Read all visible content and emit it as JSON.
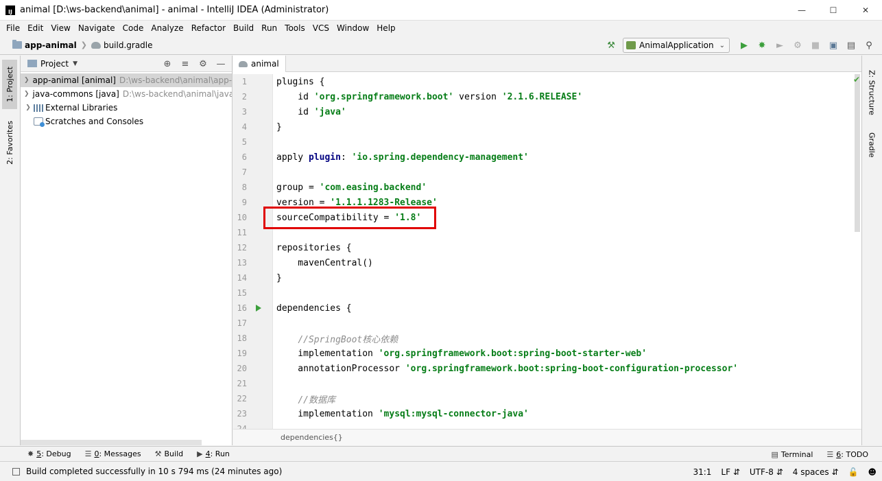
{
  "window": {
    "title": "animal [D:\\ws-backend\\animal] - animal - IntelliJ IDEA (Administrator)",
    "app_icon_letters": "IJ"
  },
  "menu": [
    "File",
    "Edit",
    "View",
    "Navigate",
    "Code",
    "Analyze",
    "Refactor",
    "Build",
    "Run",
    "Tools",
    "VCS",
    "Window",
    "Help"
  ],
  "nav": {
    "project": "app-animal",
    "file": "build.gradle",
    "run_config": "AnimalApplication"
  },
  "left_strip": {
    "project_tab": "1: Project",
    "favorites_tab": "2: Favorites"
  },
  "right_strip": {
    "structure_tab": "Z: Structure",
    "gradle_tab": "Gradle"
  },
  "project_panel": {
    "title": "Project",
    "tree": [
      {
        "name": "app-animal [animal]",
        "path": "D:\\ws-backend\\animal\\app-a",
        "selected": true,
        "icon": "module-folder-icon"
      },
      {
        "name": "java-commons [java]",
        "path": "D:\\ws-backend\\animal\\java-",
        "selected": false,
        "icon": "module-folder-icon"
      },
      {
        "name": "External Libraries",
        "path": "",
        "selected": false,
        "icon": "library-icon"
      },
      {
        "name": "Scratches and Consoles",
        "path": "",
        "selected": false,
        "icon": "scratches-icon"
      }
    ]
  },
  "editor": {
    "tab_label": "animal",
    "breadcrumb": "dependencies{}",
    "lines": [
      {
        "n": "1",
        "html": "plugins {"
      },
      {
        "n": "2",
        "html": "    id <span class=\"s\">'org.springframework.boot'</span> version <span class=\"s\">'2.1.6.RELEASE'</span>"
      },
      {
        "n": "3",
        "html": "    id <span class=\"s\">'java'</span>"
      },
      {
        "n": "4",
        "html": "}"
      },
      {
        "n": "5",
        "html": ""
      },
      {
        "n": "6",
        "html": "apply <span class=\"k\">plugin</span>: <span class=\"s\">'io.spring.dependency-management'</span>"
      },
      {
        "n": "7",
        "html": ""
      },
      {
        "n": "8",
        "html": "group = <span class=\"s\">'com.easing.backend'</span>"
      },
      {
        "n": "9",
        "html": "version = <span class=\"s\">'1.1.1.1283-Release'</span>"
      },
      {
        "n": "10",
        "html": "sourceCompatibility = <span class=\"s\">'1.8'</span>"
      },
      {
        "n": "11",
        "html": ""
      },
      {
        "n": "12",
        "html": "repositories {"
      },
      {
        "n": "13",
        "html": "    mavenCentral()"
      },
      {
        "n": "14",
        "html": "}"
      },
      {
        "n": "15",
        "html": ""
      },
      {
        "n": "16",
        "html": "dependencies {"
      },
      {
        "n": "17",
        "html": ""
      },
      {
        "n": "18",
        "html": "    <span class=\"c\">//SpringBoot核心依赖</span>"
      },
      {
        "n": "19",
        "html": "    implementation <span class=\"s\">'org.springframework.boot:spring-boot-starter-web'</span>"
      },
      {
        "n": "20",
        "html": "    annotationProcessor <span class=\"s\">'org.springframework.boot:spring-boot-configuration-processor'</span>"
      },
      {
        "n": "21",
        "html": ""
      },
      {
        "n": "22",
        "html": "    <span class=\"c\">//数据库</span>"
      },
      {
        "n": "23",
        "html": "    implementation <span class=\"s\">'mysql:mysql-connector-java'</span>"
      },
      {
        "n": "24",
        "html": ""
      }
    ]
  },
  "bottom_tools": [
    {
      "num": "5",
      "rest": ": Debug",
      "icon": "bug-icon"
    },
    {
      "num": "0",
      "rest": ": Messages",
      "icon": "messages-icon"
    },
    {
      "num": "",
      "rest": "Build",
      "icon": "hammer-icon"
    },
    {
      "num": "4",
      "rest": ": Run",
      "icon": "run-icon"
    }
  ],
  "bottom_tools_right": {
    "terminal": "Terminal",
    "todo_num": "6",
    "todo_rest": ": TODO"
  },
  "status": {
    "message": "Build completed successfully in 10 s 794 ms (24 minutes ago)",
    "position": "31:1",
    "line_sep": "LF",
    "encoding": "UTF-8",
    "indent": "4 spaces"
  },
  "colors": {
    "string": "#067d17",
    "keyword": "#000080",
    "comment": "#8c8c8c",
    "highlight": "#e00000"
  }
}
